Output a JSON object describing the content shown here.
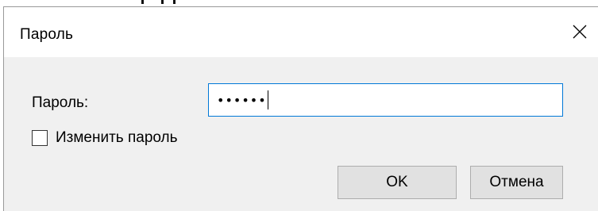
{
  "dialog": {
    "title": "Пароль",
    "close_icon": "close-icon"
  },
  "form": {
    "password_label": "Пароль:",
    "password_value": "••••••",
    "change_password_label": "Изменить пароль",
    "change_password_checked": false
  },
  "buttons": {
    "ok_label": "OK",
    "cancel_label": "Отмена"
  },
  "colors": {
    "focus_border": "#0078d7",
    "dialog_background": "#f0f0f0",
    "button_background": "#e1e1e1"
  }
}
